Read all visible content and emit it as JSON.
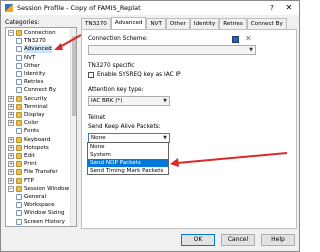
{
  "window": {
    "title": "Session Profile - Copy of FAMIS_Replat",
    "help_glyph": "?",
    "close_glyph": "✕"
  },
  "categories": {
    "label": "Categories:",
    "items": [
      {
        "label": "Connection",
        "expander": "−",
        "icon": "folder-icon"
      },
      {
        "label": "TN3270",
        "icon": "page-icon"
      },
      {
        "label": "Advanced",
        "icon": "page-icon",
        "selected": true
      },
      {
        "label": "NVT",
        "icon": "page-icon"
      },
      {
        "label": "Other",
        "icon": "page-icon"
      },
      {
        "label": "Identity",
        "icon": "page-icon"
      },
      {
        "label": "Retries",
        "icon": "page-icon"
      },
      {
        "label": "Connect By",
        "icon": "page-icon"
      },
      {
        "label": "Security",
        "expander": "+",
        "icon": "folder-icon"
      },
      {
        "label": "Terminal",
        "expander": "+",
        "icon": "folder-icon"
      },
      {
        "label": "Display",
        "expander": "+",
        "icon": "folder-icon"
      },
      {
        "label": "Color",
        "expander": "+",
        "icon": "folder-icon"
      },
      {
        "label": "Fonts",
        "icon": "page-icon"
      },
      {
        "label": "Keyboard",
        "expander": "+",
        "icon": "folder-icon"
      },
      {
        "label": "Hotspots",
        "expander": "+",
        "icon": "folder-icon"
      },
      {
        "label": "Edit",
        "expander": "+",
        "icon": "folder-icon"
      },
      {
        "label": "Print",
        "expander": "+",
        "icon": "folder-icon"
      },
      {
        "label": "File Transfer",
        "expander": "+",
        "icon": "folder-icon"
      },
      {
        "label": "FTP",
        "expander": "+",
        "icon": "folder-icon"
      },
      {
        "label": "Session Window",
        "expander": "−",
        "icon": "folder-icon"
      },
      {
        "label": "General",
        "icon": "page-icon"
      },
      {
        "label": "Workspace",
        "icon": "page-icon"
      },
      {
        "label": "Window Sizing",
        "icon": "page-icon"
      },
      {
        "label": "Screen History",
        "icon": "page-icon"
      }
    ]
  },
  "tabs": [
    {
      "label": "TN3270",
      "active": false
    },
    {
      "label": "Advanced",
      "active": true
    },
    {
      "label": "NVT",
      "active": false
    },
    {
      "label": "Other",
      "active": false
    },
    {
      "label": "Identity",
      "active": false
    },
    {
      "label": "Retries",
      "active": false
    },
    {
      "label": "Connect By",
      "active": false
    }
  ],
  "panel": {
    "connection_scheme_label": "Connection Scheme:",
    "connection_scheme_value": "",
    "tn3270_specific_label": "TN3270 specific",
    "enable_sysreq_label": "Enable SYSREQ key as IAC IP",
    "attention_key_label": "Attention key type:",
    "attention_key_value": "IAC BRK (*)",
    "telnet_label": "Telnet",
    "keep_alive_label": "Send Keep Alive Packets:",
    "keep_alive_value": "None",
    "keep_alive_options": [
      "None",
      "System",
      "Send NOP Packets",
      "Send Timing Mark Packets"
    ],
    "keep_alive_highlighted": "Send NOP Packets"
  },
  "buttons": {
    "ok": "OK",
    "cancel": "Cancel",
    "help": "Help"
  },
  "colors": {
    "accent": "#0078d7",
    "annotation_arrow": "#d92b2b",
    "selected_item": "#cfe3f7"
  }
}
